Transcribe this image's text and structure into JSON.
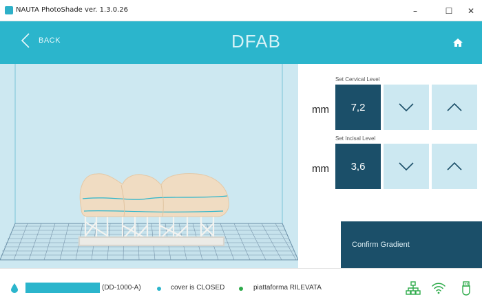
{
  "window": {
    "title": "NAUTA PhotoShade ver. 1.3.0.26",
    "controls": {
      "minimize": "–",
      "maximize": "☐",
      "close": "✕"
    }
  },
  "header": {
    "back_label": "BACK",
    "brand": "DFAB",
    "icons": [
      "chevron-left-icon",
      "home-icon"
    ]
  },
  "viewport": {
    "description_icon": "3d-model-view"
  },
  "panel": {
    "cervical": {
      "label": "Set Cervical Level",
      "unit": "mm",
      "value": "7,2"
    },
    "incisal": {
      "label": "Set Incisal Level",
      "unit": "mm",
      "value": "3,6"
    },
    "confirm_label": "Confirm Gradient"
  },
  "status": {
    "resin_code": "(DD-1000-A)",
    "cover": "cover is CLOSED",
    "platform": "piattaforma RILEVATA",
    "icons": [
      "drop-icon",
      "network-icon",
      "wifi-icon",
      "usb-icon"
    ]
  },
  "colors": {
    "accent": "#2bb5cc",
    "dark": "#1b4f69",
    "light_button": "#cce8f1",
    "viewport_bg": "#cde8f1",
    "status_ok": "#2daa4a"
  }
}
